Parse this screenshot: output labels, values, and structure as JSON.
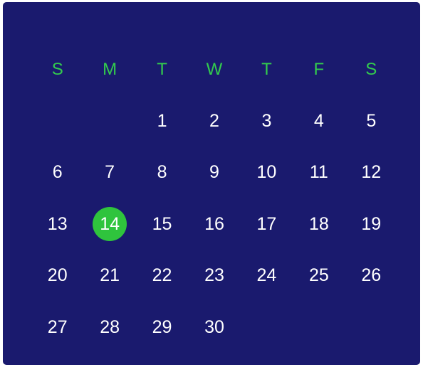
{
  "colors": {
    "background": "#1a1a6e",
    "accent": "#2fc43d",
    "weekday_text": "#33cc4d",
    "day_text": "#ffffff"
  },
  "calendar": {
    "weekdays": [
      "S",
      "M",
      "T",
      "W",
      "T",
      "F",
      "S"
    ],
    "selected_day": "14",
    "weeks": [
      [
        "",
        "",
        "1",
        "2",
        "3",
        "4",
        "5"
      ],
      [
        "6",
        "7",
        "8",
        "9",
        "10",
        "11",
        "12"
      ],
      [
        "13",
        "14",
        "15",
        "16",
        "17",
        "18",
        "19"
      ],
      [
        "20",
        "21",
        "22",
        "23",
        "24",
        "25",
        "26"
      ],
      [
        "27",
        "28",
        "29",
        "30",
        "",
        "",
        ""
      ]
    ]
  }
}
